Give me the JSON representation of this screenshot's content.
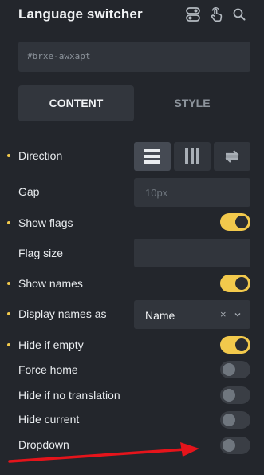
{
  "panel": {
    "title": "Language switcher",
    "element_id": "#brxe-awxapt"
  },
  "header_icons": [
    "toggle-settings-icon",
    "pointer-hand-icon",
    "search-icon"
  ],
  "tabs": [
    {
      "label": "CONTENT",
      "active": true
    },
    {
      "label": "STYLE",
      "active": false
    }
  ],
  "controls": {
    "direction": {
      "label": "Direction",
      "options": [
        "rows-icon",
        "columns-icon",
        "swap-icon"
      ],
      "selected": 0
    },
    "gap": {
      "label": "Gap",
      "placeholder": "10px"
    },
    "show_flags": {
      "label": "Show flags",
      "on": true
    },
    "flag_size": {
      "label": "Flag size",
      "value": ""
    },
    "show_names": {
      "label": "Show names",
      "on": true
    },
    "display_names_as": {
      "label": "Display names as",
      "value": "Name",
      "clear": "×"
    },
    "hide_if_empty": {
      "label": "Hide if empty",
      "on": true
    },
    "force_home": {
      "label": "Force home",
      "on": false
    },
    "hide_if_no_translation": {
      "label": "Hide if no translation",
      "on": false
    },
    "hide_current": {
      "label": "Hide current",
      "on": false
    },
    "dropdown": {
      "label": "Dropdown",
      "on": false
    }
  },
  "colors": {
    "background": "#23262c",
    "accent": "#f2c94c",
    "annotation_arrow": "#e5141b"
  }
}
